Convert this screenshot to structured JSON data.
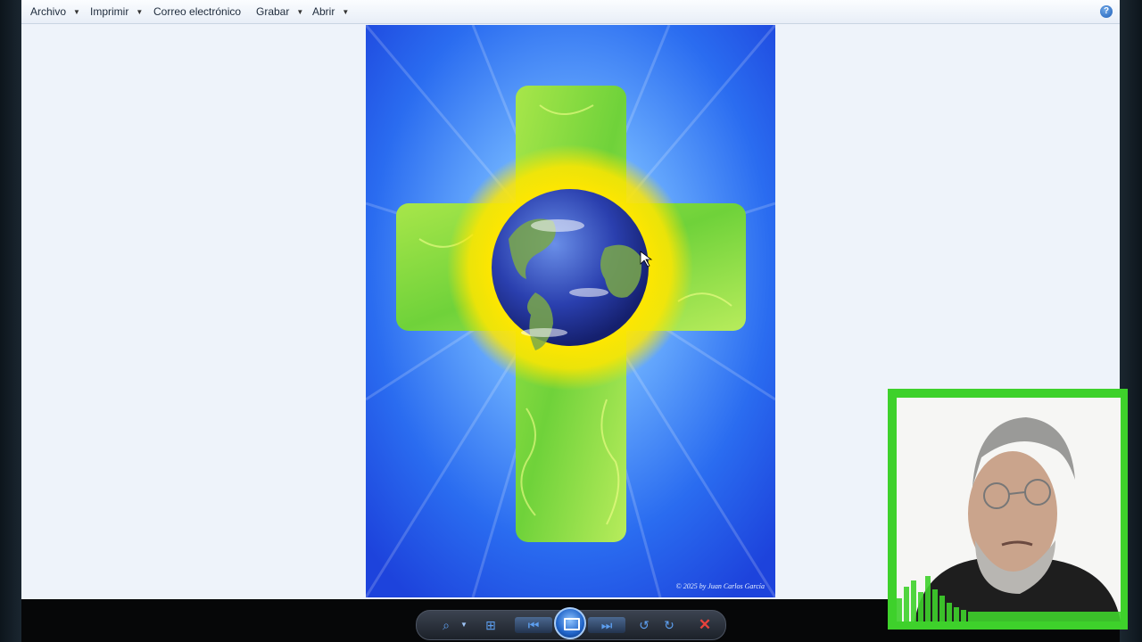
{
  "menu": {
    "items": [
      {
        "label": "Archivo",
        "has_dropdown": true
      },
      {
        "label": "Imprimir",
        "has_dropdown": true
      },
      {
        "label": "Correo electrónico",
        "has_dropdown": false
      },
      {
        "label": "Grabar",
        "has_dropdown": true
      },
      {
        "label": "Abrir",
        "has_dropdown": true
      }
    ],
    "help_glyph": "?"
  },
  "image": {
    "copyright": "© 2025 by Juan Carlos García",
    "description_icon": "cross-earth-artwork"
  },
  "controls": {
    "icons": [
      "zoom-icon",
      "actual-size-icon",
      "previous-icon",
      "slideshow-icon",
      "next-icon",
      "rotate-left-icon",
      "rotate-right-icon",
      "delete-icon"
    ]
  },
  "colors": {
    "accent_green": "#3ed12b",
    "menu_bg": "#eef3fa",
    "delete_red": "#e8423c"
  }
}
